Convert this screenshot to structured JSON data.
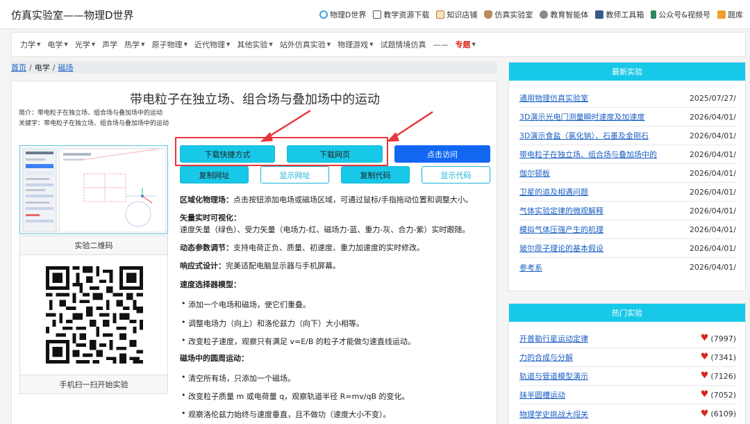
{
  "header": {
    "title": "仿真实验室——物理D世界",
    "links": [
      {
        "label": "物理D世界",
        "icon": "globe-icon",
        "color": "#3aa0d8"
      },
      {
        "label": "教学资源下载",
        "icon": "window-icon",
        "color": "#555555"
      },
      {
        "label": "知识店铺",
        "icon": "shop-icon",
        "color": "#c57a2a"
      },
      {
        "label": "仿真实验室",
        "icon": "flask-icon",
        "color": "#8a5a2a"
      },
      {
        "label": "教育智能体",
        "icon": "robot-icon",
        "color": "#6b6b6b"
      },
      {
        "label": "教师工具箱",
        "icon": "toolbox-icon",
        "color": "#3b5a8a"
      },
      {
        "label": "公众号&视频号",
        "icon": "phone-icon",
        "color": "#2a8a5a"
      },
      {
        "label": "题库",
        "icon": "pen-icon",
        "color": "#e08a1a"
      }
    ]
  },
  "nav": {
    "items": [
      "力学",
      "电学",
      "光学",
      "声学",
      "热学",
      "原子物理",
      "近代物理",
      "其他实验",
      "站外仿真实验",
      "物理游戏",
      "试题情境仿真",
      "——",
      "专题"
    ],
    "dropdown_flags": [
      true,
      true,
      true,
      false,
      true,
      true,
      true,
      true,
      true,
      true,
      false,
      false,
      true
    ]
  },
  "breadcrumb": {
    "home": "首页",
    "sep": "/",
    "category": "电学",
    "current": "磁场"
  },
  "main": {
    "title": "带电粒子在独立场、组合场与叠加场中的运动",
    "summary": "简介：带电粒子在独立场、组合场与叠加场中的运动",
    "keywords": "关键字：带电粒子在独立场、组合场与叠加场中的运动",
    "qr_label": "实验二维码",
    "scan_label": "手机扫一扫开始实验",
    "buttons": {
      "download_shortcut": "下载快捷方式",
      "download_page": "下载网页",
      "visit": "点击访问",
      "copy_url": "复制网址",
      "show_url": "显示网址",
      "copy_code": "复制代码",
      "show_code": "显示代码"
    },
    "features": [
      {
        "label": "区域化物理场：",
        "text": "点击按钮添加电场或磁场区域，可通过鼠标/手指拖动位置和调整大小。"
      },
      {
        "label": "矢量实时可视化：",
        "text": ""
      },
      {
        "label": "",
        "text": "速度矢量（绿色）、受力矢量（电场力-红、磁场力-蓝、重力-灰、合力-紫）实时跟随。"
      },
      {
        "label": "动态参数调节：",
        "text": "支持电荷正负、质量、初速度、重力加速度的实时修改。"
      },
      {
        "label": "响应式设计：",
        "text": "完美适配电脑显示器与手机屏幕。"
      },
      {
        "label": "速度选择器模型：",
        "text": ""
      }
    ],
    "bullets_1": [
      "添加一个电场和磁场，使它们重叠。",
      "调整电场力（向上）和洛伦兹力（向下）大小相等。",
      "改变粒子速度，观察只有满足 v=E/B 的粒子才能做匀速直线运动。"
    ],
    "section_2": "磁场中的圆周运动：",
    "bullets_2": [
      "清空所有场，只添加一个磁场。",
      "改变粒子质量 m 或电荷量 q，观察轨道半径 R=mv/qB 的变化。",
      "观察洛伦兹力始终与速度垂直，且不做功（速度大小不变）。"
    ]
  },
  "sidebar": {
    "latest_title": "最新实验",
    "latest": [
      {
        "title": "通用物理仿真实验室",
        "date": "2025/07/27/"
      },
      {
        "title": "3D演示光电门测量瞬时速度及加速度",
        "date": "2026/04/01/"
      },
      {
        "title": "3D演示食盐（氯化钠）、石墨及金刚石",
        "date": "2026/04/01/"
      },
      {
        "title": "带电粒子在独立场、组合场与叠加场中的",
        "date": "2026/04/01/"
      },
      {
        "title": "伽尔顿板",
        "date": "2026/04/01/"
      },
      {
        "title": "卫星的追及相遇问题",
        "date": "2026/04/01/"
      },
      {
        "title": "气体实验定律的微观解释",
        "date": "2026/04/01/"
      },
      {
        "title": "模拟气体压强产生的机理",
        "date": "2026/04/01/"
      },
      {
        "title": "玻尔原子理论的基本假设",
        "date": "2026/04/01/"
      },
      {
        "title": "参考系",
        "date": "2026/04/01/"
      }
    ],
    "hot_title": "热门实验",
    "hot": [
      {
        "title": "开普勒行星运动定律",
        "count": "(7997)"
      },
      {
        "title": "力的合成与分解",
        "count": "(7341)"
      },
      {
        "title": "轨道与管道模型演示",
        "count": "(7126)"
      },
      {
        "title": "抹半圆槽运动",
        "count": "(7052)"
      },
      {
        "title": "物理学史挑战大闯关",
        "count": "(6109)"
      }
    ]
  },
  "colors": {
    "accent": "#18c8e8",
    "primary": "#1167f2",
    "annotation": "#e8343a",
    "link": "#1a5fc4"
  }
}
